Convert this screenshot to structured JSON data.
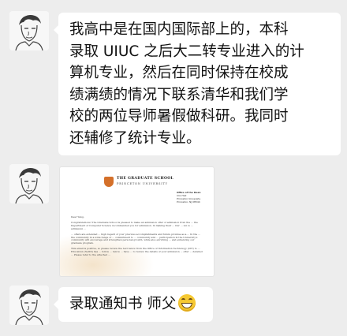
{
  "messages": [
    {
      "sender": "other",
      "type": "text",
      "lines": [
        "我高中是在国内国际部上的，本科",
        "录取 UIUC 之后大二转专业进入的计",
        "算机专业，然后在同时保持在校成",
        "绩满绩的情况下联系清华和我们学",
        "校的两位导师暑假做科研。我同时",
        "还辅修了统计专业。"
      ]
    },
    {
      "sender": "other",
      "type": "image",
      "letter": {
        "school": "THE GRADUATE SCHOOL",
        "university": "PRINCETON UNIVERSITY",
        "office": [
          "Office of the Dean",
          "Clio Hall",
          "Princeton University",
          "Princeton, NJ 08544"
        ],
        "salutation": "Dear Yang,",
        "paragraphs": [
          "Congratulations! The Graduate School is pleased to make an admission offer of admission from the ... the Department of Computer Science recommended you for admission. In making their ... Our ... ion is ... admission ...",
          "... offers are extended ... high regard of your previous accomplishments and future promise as a ... In the ... the community in a wide range of ... commitment to ... community and ... participation in the University's community will encourage and strengthen personal growth, while also enriching ... and enhancing our graduate program.",
          "This email is positive, so please review the text below from the Office of Information Technology (OIT) to ... Education (NetID) has ... follow ... below ... have ... to review the details of your admission ... offer ... detailed ... Please refer to the attached ..."
        ]
      }
    },
    {
      "sender": "other",
      "type": "text",
      "text": "录取通知书 师父",
      "emoji": "grin-emoji"
    }
  ],
  "colors": {
    "background": "#ededed",
    "bubble": "#ffffff",
    "accent": "#d4702a"
  }
}
